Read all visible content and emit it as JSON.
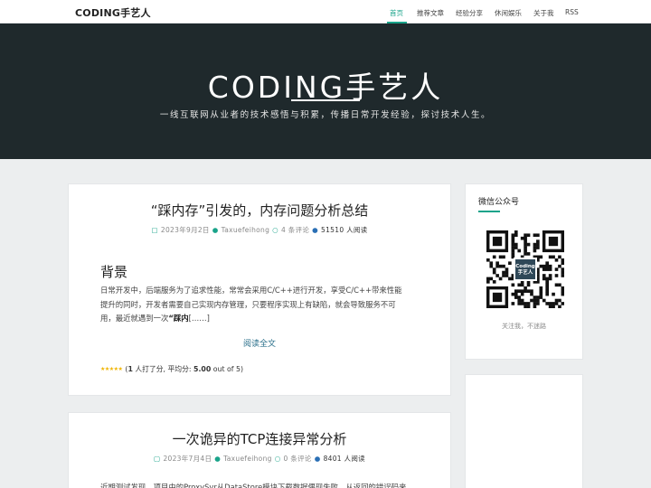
{
  "navbar": {
    "brand": "CODING手艺人",
    "items": [
      {
        "label": "首页",
        "active": true
      },
      {
        "label": "推荐文章",
        "active": false
      },
      {
        "label": "经验分享",
        "active": false
      },
      {
        "label": "休闲娱乐",
        "active": false
      },
      {
        "label": "关于我",
        "active": false
      },
      {
        "label": "RSS",
        "active": false
      }
    ]
  },
  "hero": {
    "title": "CODING手艺人",
    "subtitle": "一线互联网从业者的技术感悟与积累，传播日常开发经验，探讨技术人生。"
  },
  "posts": [
    {
      "title": "“踩内存”引发的，内存问题分析总结",
      "date": "2023年9月2日",
      "author": "Taxuefeihong",
      "comments": "4 条评论",
      "views": "51510 人阅读",
      "section_heading": "背景",
      "excerpt_lines": [
        "日常开发中，后端服务为了追求性能，常常会采用C/C++进行开发，享受C/C++带来性能",
        "提升的同时，开发者需要自己实现内存管理，只要程序实现上有缺陷，就会导致服务不可",
        "用，最近就遇到一次"
      ],
      "excerpt_bold": "“踩内",
      "excerpt_tail": "[……]",
      "read_more": "阅读全文",
      "rating_prefix": "(",
      "rating_count": "1",
      "rating_mid": " 人打了分, 平均分: ",
      "rating_avg": "5.00",
      "rating_suffix": " out of 5)",
      "stars": 5
    },
    {
      "title": "一次诡异的TCP连接异常分析",
      "date": "2023年7月4日",
      "author": "Taxuefeihong",
      "comments": "0 条评论",
      "views": "8401 人阅读",
      "excerpt_line": "近期测试发现，项目中的ProxySvr从DataStore模块下载数据偶现失败，从返回的错误码来"
    }
  ],
  "sidebar": {
    "wechat_title": "微信公众号",
    "qr_logo_line1": "Coding",
    "qr_logo_line2": "手艺人",
    "qr_caption": "关注我，不迷路"
  },
  "colors": {
    "accent": "#19a38a",
    "hero_bg": "#1f292c",
    "page_bg": "#eceeef",
    "link": "#2a6f8a",
    "star": "#f0b400"
  }
}
